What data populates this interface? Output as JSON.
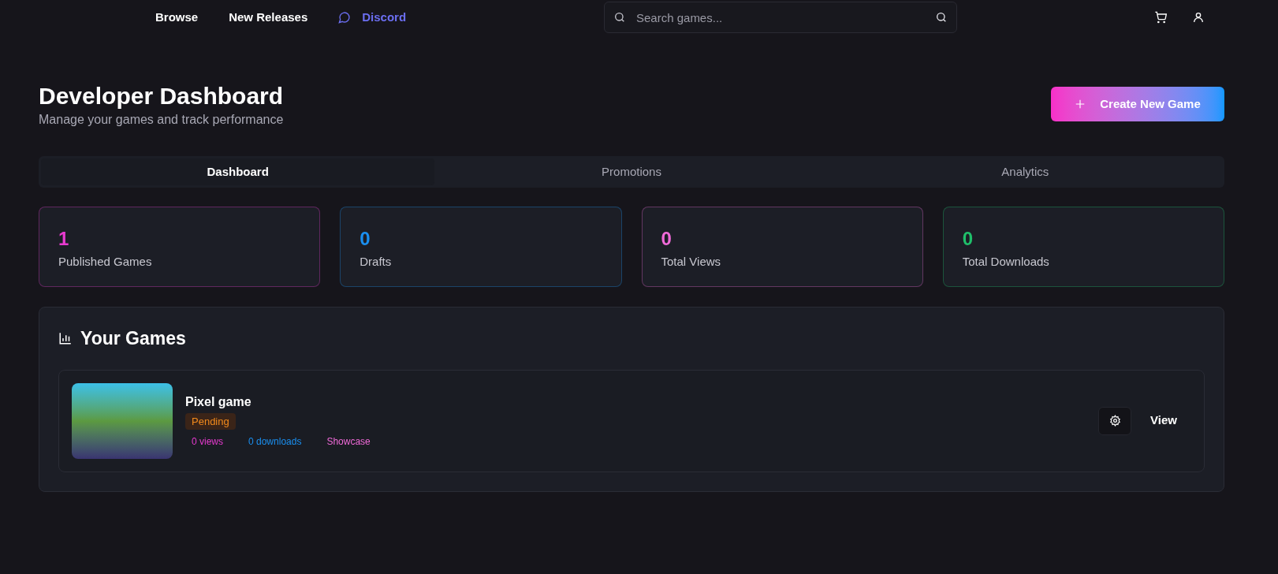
{
  "nav": {
    "links": [
      {
        "label": "Browse",
        "kind": "plain"
      },
      {
        "label": "New Releases",
        "kind": "plain"
      },
      {
        "label": "Discord",
        "kind": "discord"
      }
    ],
    "search": {
      "placeholder": "Search games..."
    }
  },
  "header": {
    "title": "Developer Dashboard",
    "subtitle": "Manage your games and track performance",
    "create_button": "Create New Game"
  },
  "tabs": [
    {
      "label": "Dashboard",
      "selected": true
    },
    {
      "label": "Promotions",
      "selected": false
    },
    {
      "label": "Analytics",
      "selected": false
    }
  ],
  "stats": [
    {
      "value": "1",
      "label": "Published Games",
      "color": "#e83ad0"
    },
    {
      "value": "0",
      "label": "Drafts",
      "color": "#1a8ff0"
    },
    {
      "value": "0",
      "label": "Total Views",
      "color": "#f06ad8"
    },
    {
      "value": "0",
      "label": "Total Downloads",
      "color": "#1fbf6a"
    }
  ],
  "games_panel": {
    "title": "Your Games",
    "games": [
      {
        "title": "Pixel game",
        "status": "Pending",
        "meta": [
          {
            "text": "0 views",
            "color": "#e83ad0"
          },
          {
            "text": "0 downloads",
            "color": "#1a8ff0"
          },
          {
            "text": "Showcase",
            "color": "#f06ad8"
          }
        ],
        "view_button": "View"
      }
    ]
  }
}
